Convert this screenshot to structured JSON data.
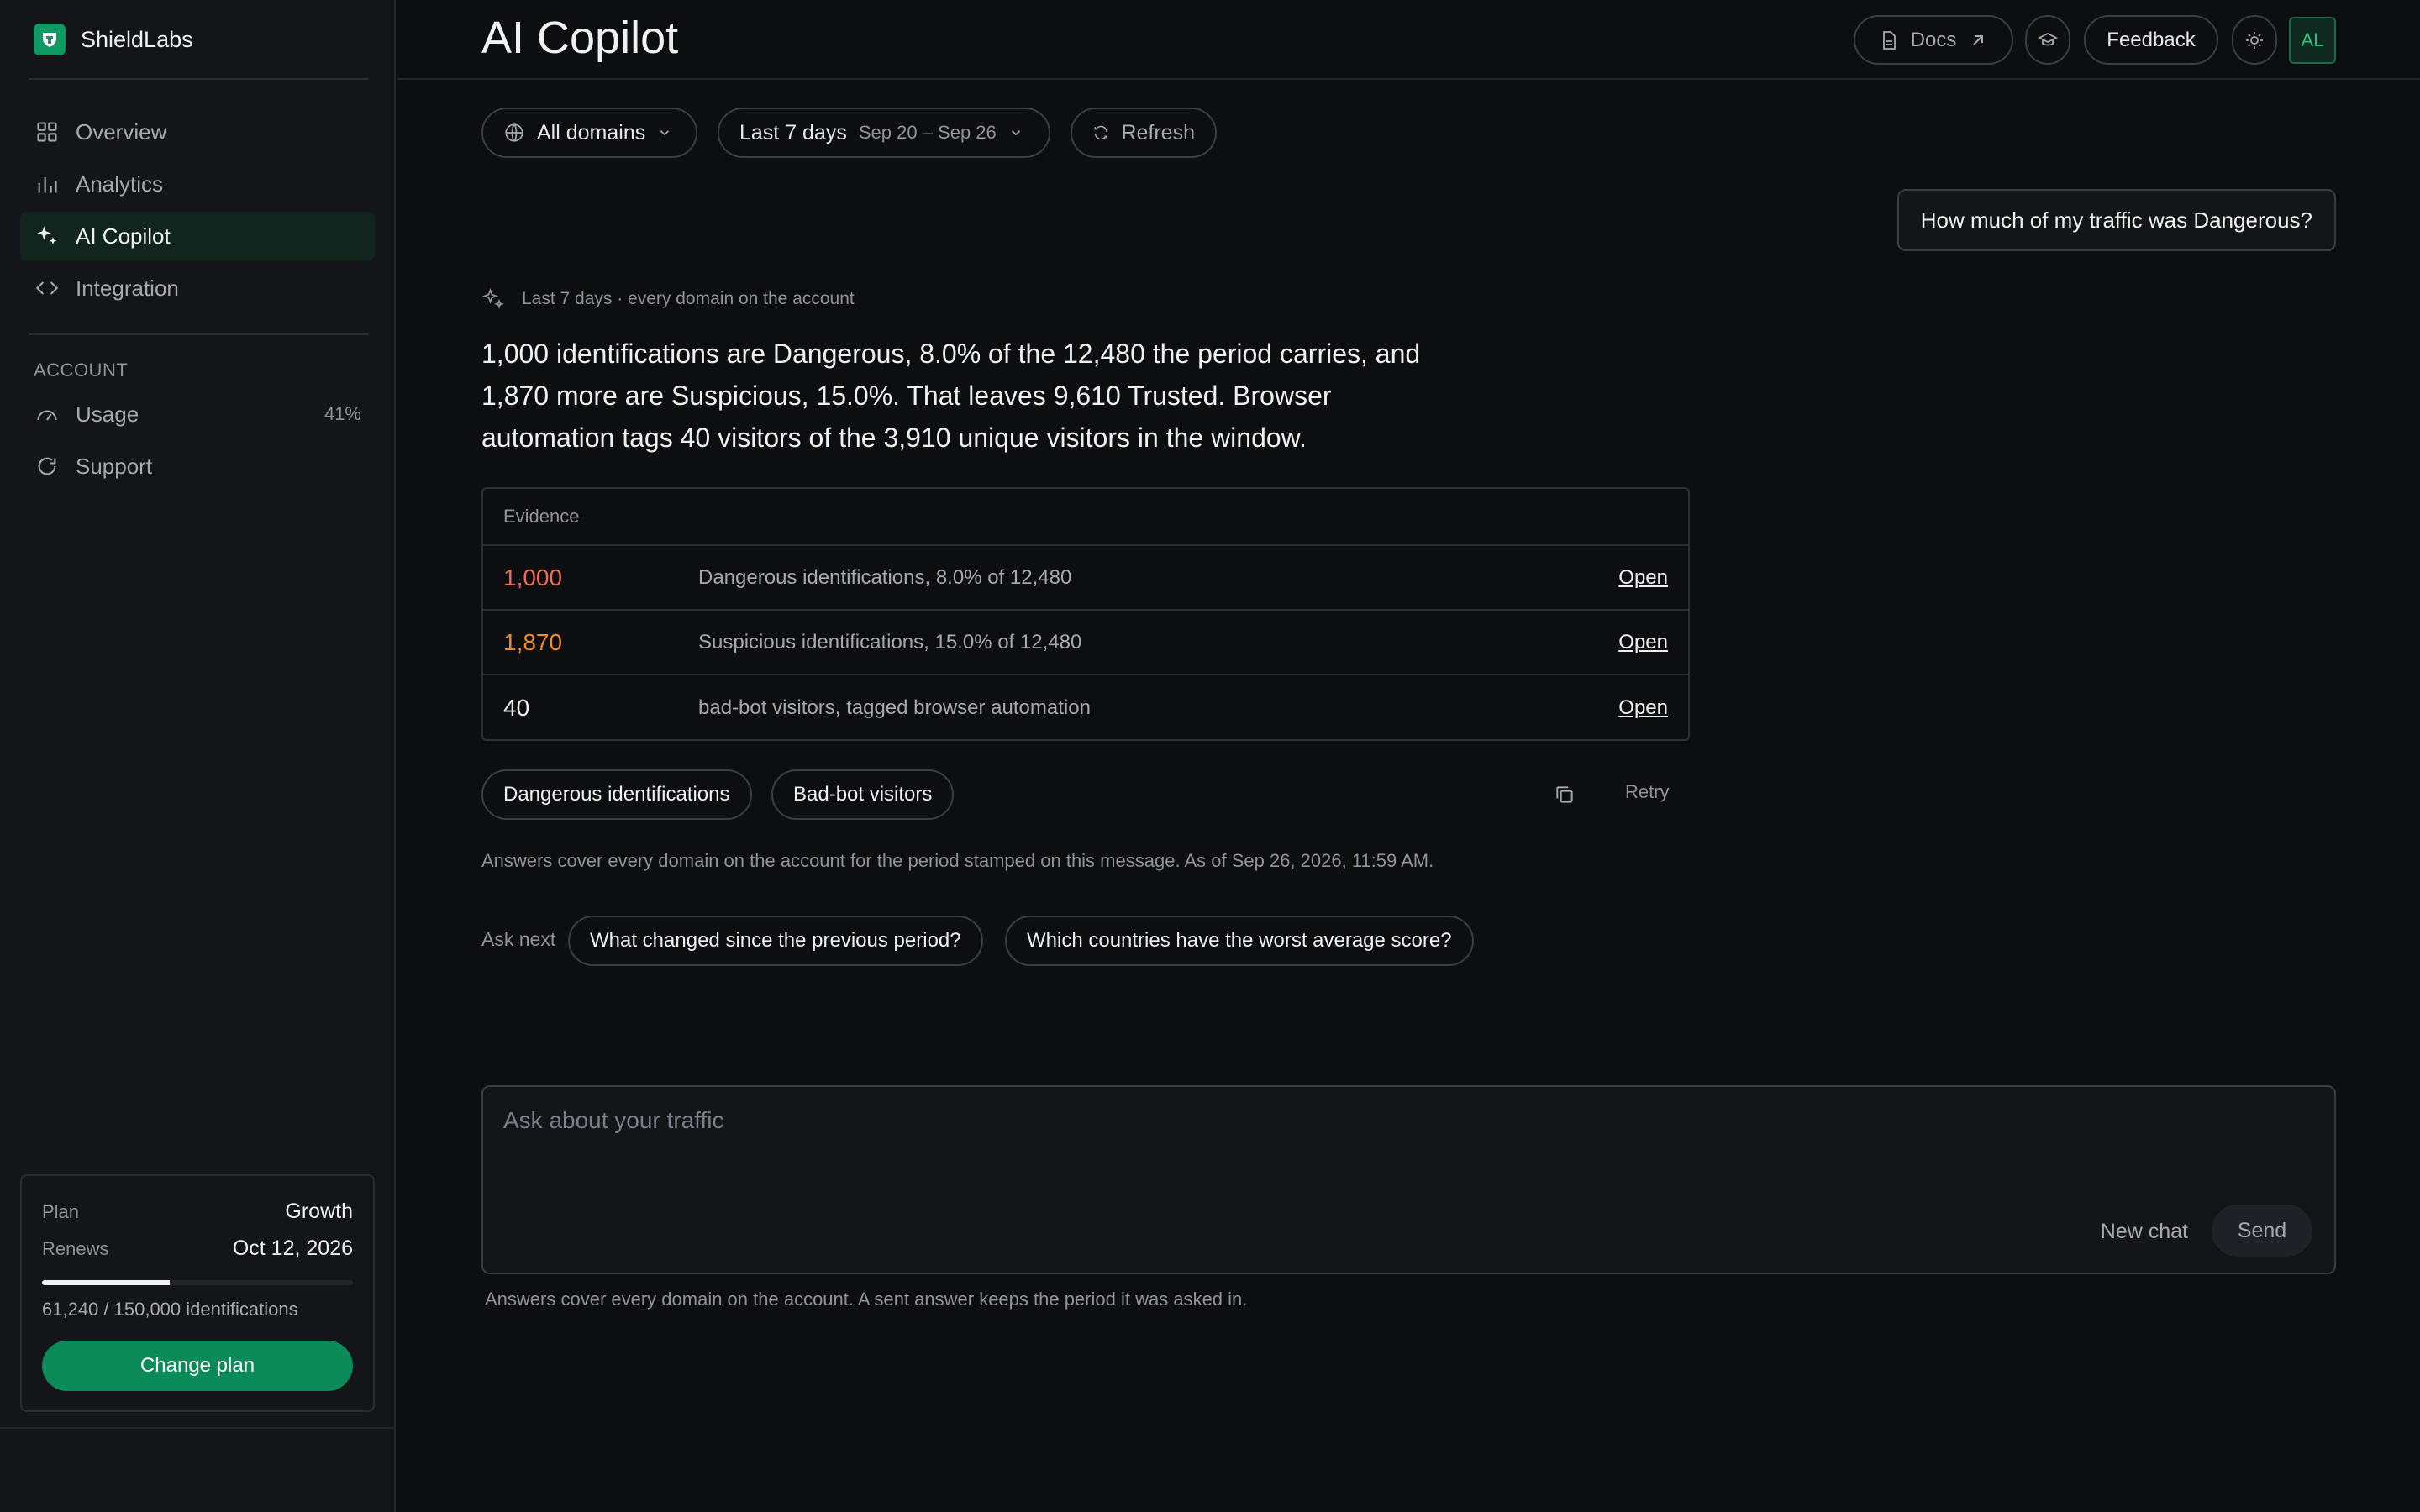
{
  "brand": {
    "name": "ShieldLabs"
  },
  "sidebar": {
    "items": [
      {
        "label": "Overview",
        "icon": "grid-icon"
      },
      {
        "label": "Analytics",
        "icon": "bar-chart-icon"
      },
      {
        "label": "AI Copilot",
        "icon": "sparkle-icon",
        "active": true
      },
      {
        "label": "Integration",
        "icon": "code-icon"
      }
    ],
    "account_label": "ACCOUNT",
    "account_items": [
      {
        "label": "Usage",
        "icon": "gauge-icon",
        "value": "41%"
      },
      {
        "label": "Support",
        "icon": "chat-icon"
      }
    ]
  },
  "plan": {
    "plan_key": "Plan",
    "plan_value": "Growth",
    "renews_key": "Renews",
    "renews_value": "Oct 12, 2026",
    "usage_text": "61,240 / 150,000 identifications",
    "usage_fraction": 0.41,
    "button_label": "Change plan"
  },
  "header": {
    "title": "AI Copilot",
    "docs_label": "Docs",
    "feedback_label": "Feedback",
    "avatar_initials": "AL"
  },
  "filters": {
    "domains_label": "All domains",
    "period_label": "Last 7 days",
    "period_range": "Sep 20 – Sep 26",
    "refresh_label": "Refresh"
  },
  "chat": {
    "user_message": "How much of my traffic was Dangerous?",
    "answer_meta": "Last 7 days · every domain on the account",
    "answer_text": "1,000 identifications are Dangerous, 8.0% of the 12,480 the period carries, and 1,870 more are Suspicious, 15.0%. That leaves 9,610 Trusted. Browser automation tags 40 visitors of the 3,910 unique visitors in the window.",
    "evidence_title": "Evidence",
    "evidence_rows": [
      {
        "value": "1,000",
        "desc": "Dangerous identifications, 8.0% of 12,480",
        "link": "Open",
        "color": "#f06a5a"
      },
      {
        "value": "1,870",
        "desc": "Suspicious identifications, 15.0% of 12,480",
        "link": "Open",
        "color": "#ef8a2e"
      },
      {
        "value": "40",
        "desc": "bad-bot visitors, tagged browser automation",
        "link": "Open",
        "color": "#eef0f2"
      }
    ],
    "chips": [
      "Dangerous identifications",
      "Bad-bot visitors"
    ],
    "retry_label": "Retry",
    "footnote": "Answers cover every domain on the account for the period stamped on this message. As of Sep 26, 2026, 11:59 AM.",
    "ask_next_label": "Ask next",
    "ask_next": [
      "What changed since the previous period?",
      "Which countries have the worst average score?"
    ]
  },
  "composer": {
    "placeholder": "Ask about your traffic",
    "new_chat_label": "New chat",
    "send_label": "Send",
    "note": "Answers cover every domain on the account. A sent answer keeps the period it was asked in."
  },
  "colors": {
    "accent": "#0b8a5a",
    "dangerous": "#f06a5a",
    "suspicious": "#ef8a2e"
  }
}
